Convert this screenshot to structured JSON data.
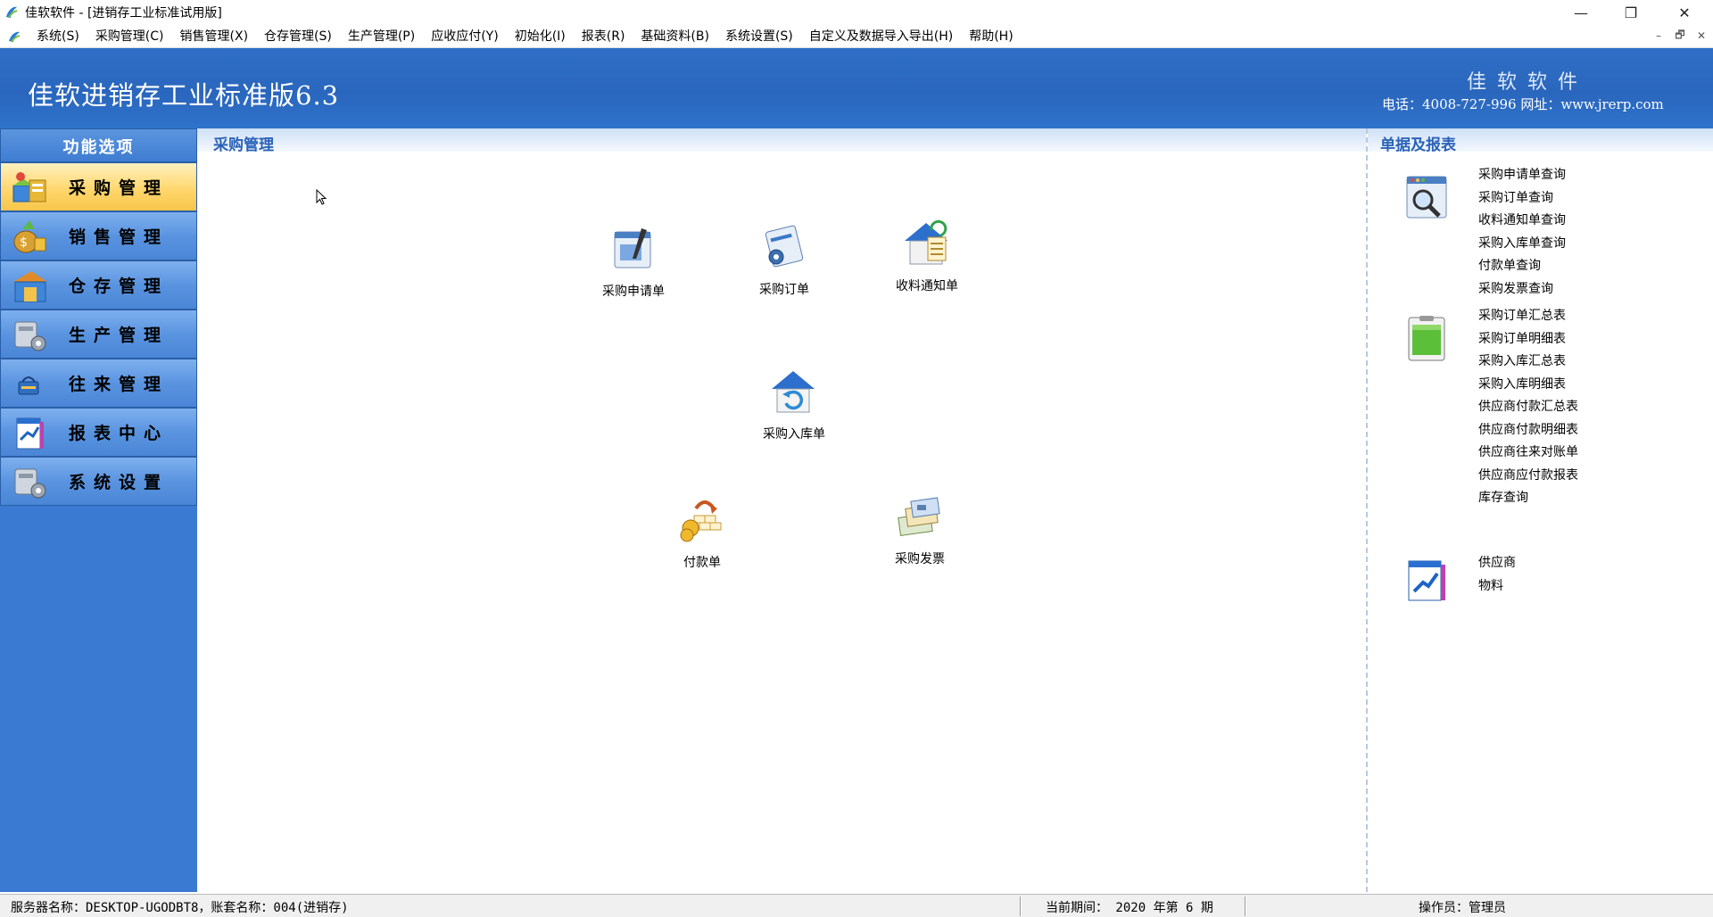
{
  "window": {
    "title": "佳软软件 - [进销存工业标准试用版]",
    "min": "—",
    "max": "❐",
    "close": "✕"
  },
  "menu": [
    "系统(S)",
    "采购管理(C)",
    "销售管理(X)",
    "仓存管理(S)",
    "生产管理(P)",
    "应收应付(Y)",
    "初始化(I)",
    "报表(R)",
    "基础资料(B)",
    "系统设置(S)",
    "自定义及数据导入导出(H)",
    "帮助(H)"
  ],
  "mdi_controls": {
    "min": "–",
    "restore": "🗗",
    "close": "✕"
  },
  "banner": {
    "product": "佳软进销存工业标准版6.3",
    "company": "佳软软件",
    "contact": "电话：4008-727-996  网址：www.jrerp.com"
  },
  "sidebar": {
    "title": "功能选项",
    "items": [
      {
        "label": "采购管理",
        "icon": "purchase-icon",
        "active": true
      },
      {
        "label": "销售管理",
        "icon": "sales-icon"
      },
      {
        "label": "仓存管理",
        "icon": "warehouse-icon"
      },
      {
        "label": "生产管理",
        "icon": "production-icon"
      },
      {
        "label": "往来管理",
        "icon": "accounts-icon"
      },
      {
        "label": "报表中心",
        "icon": "report-icon"
      },
      {
        "label": "系统设置",
        "icon": "settings-icon"
      }
    ]
  },
  "center": {
    "title": "采购管理",
    "tiles": [
      {
        "label": "采购申请单",
        "icon": "purchase-request-icon"
      },
      {
        "label": "采购订单",
        "icon": "purchase-order-icon"
      },
      {
        "label": "收料通知单",
        "icon": "receiving-notice-icon"
      },
      {
        "label": "采购入库单",
        "icon": "purchase-receipt-icon"
      },
      {
        "label": "付款单",
        "icon": "payment-icon"
      },
      {
        "label": "采购发票",
        "icon": "purchase-invoice-icon"
      }
    ]
  },
  "right": {
    "title": "单据及报表",
    "groups": [
      {
        "icon": "query-magnifier-icon",
        "links": [
          "采购申请单查询",
          "采购订单查询",
          "收料通知单查询",
          "采购入库单查询",
          "付款单查询",
          "采购发票查询"
        ]
      },
      {
        "icon": "report-document-icon",
        "links": [
          "采购订单汇总表",
          "采购订单明细表",
          "采购入库汇总表",
          "采购入库明细表",
          "供应商付款汇总表",
          "供应商付款明细表",
          "供应商往来对账单",
          "供应商应付款报表",
          "库存查询"
        ]
      },
      {
        "icon": "master-data-icon",
        "links": [
          "供应商",
          "物料"
        ]
      }
    ]
  },
  "status": {
    "server": "服务器名称：DESKTOP-UGODBT8，账套名称：004(进销存)",
    "period": "当前期间：  2020 年第 6 期",
    "operator": "操作员：管理员"
  }
}
